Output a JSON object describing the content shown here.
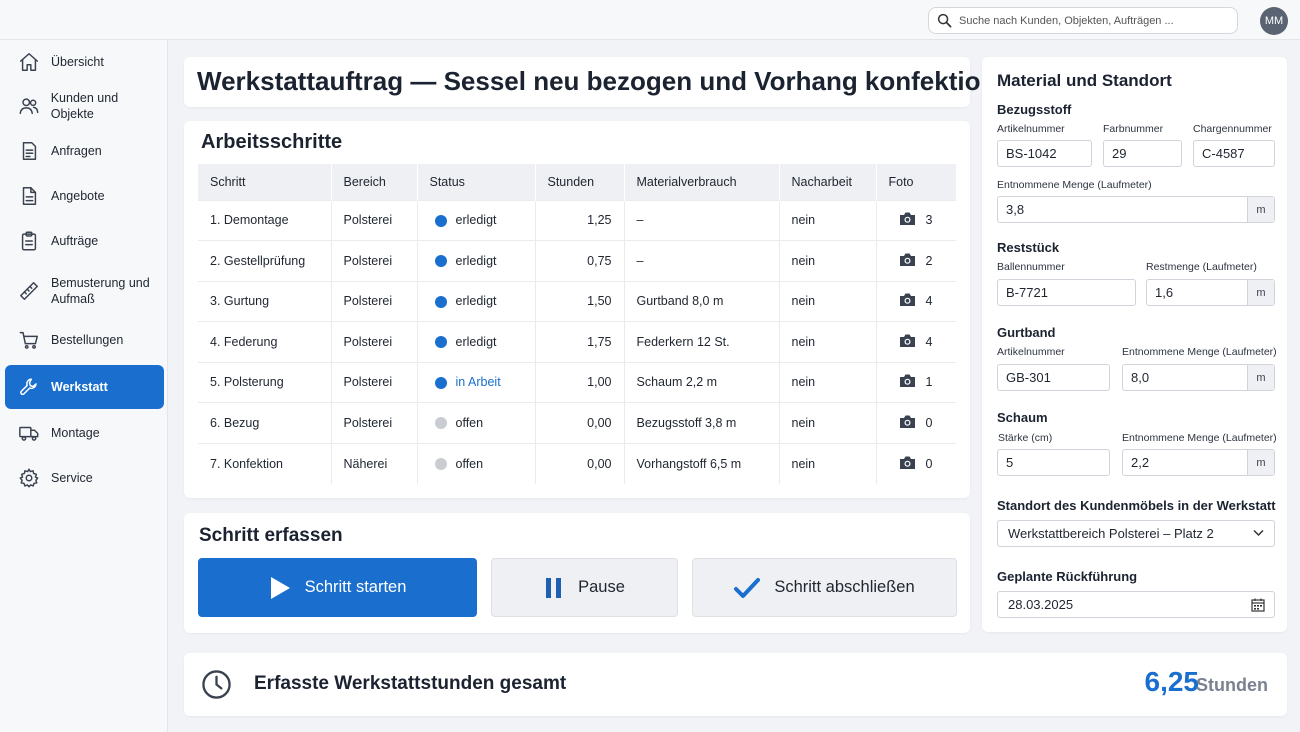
{
  "topbar": {
    "search_placeholder": "Suche nach Kunden, Objekten, Aufträgen ...",
    "avatar_initials": "MM"
  },
  "sidebar": {
    "items": [
      {
        "label": "Übersicht",
        "icon": "home-icon",
        "active": false
      },
      {
        "label": "Kunden und Objekte",
        "icon": "users-icon",
        "active": false
      },
      {
        "label": "Anfragen",
        "icon": "document-icon",
        "active": false
      },
      {
        "label": "Angebote",
        "icon": "document-icon",
        "active": false
      },
      {
        "label": "Aufträge",
        "icon": "clipboard-icon",
        "active": false
      },
      {
        "label": "Bemusterung und Aufmaß",
        "icon": "ruler-icon",
        "active": false
      },
      {
        "label": "Bestellungen",
        "icon": "cart-icon",
        "active": false
      },
      {
        "label": "Werkstatt",
        "icon": "wrench-icon",
        "active": true
      },
      {
        "label": "Montage",
        "icon": "truck-icon",
        "active": false
      },
      {
        "label": "Service",
        "icon": "gear-icon",
        "active": false
      }
    ]
  },
  "page": {
    "title": "Werkstattauftrag — Sessel neu bezogen und Vorhang konfektionieren"
  },
  "steps": {
    "heading": "Arbeitsschritte",
    "columns": [
      "Schritt",
      "Bereich",
      "Status",
      "Stunden",
      "Materialverbrauch",
      "Nacharbeit",
      "Foto"
    ],
    "rows": [
      {
        "step": "1.  Demontage",
        "area": "Polsterei",
        "status": "erledigt",
        "state": "done",
        "hours": "1,25",
        "material": "–",
        "rework": "nein",
        "photos": "3"
      },
      {
        "step": "2.  Gestellprüfung",
        "area": "Polsterei",
        "status": "erledigt",
        "state": "done",
        "hours": "0,75",
        "material": "–",
        "rework": "nein",
        "photos": "2"
      },
      {
        "step": "3.  Gurtung",
        "area": "Polsterei",
        "status": "erledigt",
        "state": "done",
        "hours": "1,50",
        "material": "Gurtband 8,0 m",
        "rework": "nein",
        "photos": "4"
      },
      {
        "step": "4.  Federung",
        "area": "Polsterei",
        "status": "erledigt",
        "state": "done",
        "hours": "1,75",
        "material": "Federkern 12 St.",
        "rework": "nein",
        "photos": "4"
      },
      {
        "step": "5.  Polsterung",
        "area": "Polsterei",
        "status": "in Arbeit",
        "state": "work",
        "hours": "1,00",
        "material": "Schaum 2,2 m",
        "rework": "nein",
        "photos": "1"
      },
      {
        "step": "6.  Bezug",
        "area": "Polsterei",
        "status": "offen",
        "state": "open",
        "hours": "0,00",
        "material": "Bezugsstoff 3,8 m",
        "rework": "nein",
        "photos": "0"
      },
      {
        "step": "7.  Konfektion",
        "area": "Näherei",
        "status": "offen",
        "state": "open",
        "hours": "0,00",
        "material": "Vorhangstoff 6,5 m",
        "rework": "nein",
        "photos": "0"
      }
    ]
  },
  "record": {
    "heading": "Schritt erfassen",
    "start_label": "Schritt starten",
    "pause_label": "Pause",
    "finish_label": "Schritt abschließen"
  },
  "total": {
    "label": "Erfasste Werkstattstunden gesamt",
    "value": "6,25",
    "unit": "Stunden"
  },
  "material": {
    "heading": "Material und Standort",
    "bezugsstoff": {
      "heading": "Bezugsstoff",
      "article_label": "Artikelnummer",
      "article": "BS-1042",
      "color_label": "Farbnummer",
      "color": "29",
      "batch_label": "Chargennummer",
      "batch": "C-4587",
      "qty_label": "Entnommene Menge (Laufmeter)",
      "qty": "3,8",
      "unit": "m"
    },
    "reststueck": {
      "heading": "Reststück",
      "bale_label": "Ballennummer",
      "bale": "B-7721",
      "rest_label": "Restmenge (Laufmeter)",
      "rest": "1,6",
      "unit": "m"
    },
    "gurtband": {
      "heading": "Gurtband",
      "article_label": "Artikelnummer",
      "article": "GB-301",
      "qty_label": "Entnommene Menge (Laufmeter)",
      "qty": "8,0",
      "unit": "m"
    },
    "schaum": {
      "heading": "Schaum",
      "thickness_label": "Stärke (cm)",
      "thickness": "5",
      "qty_label": "Entnommene Menge (Laufmeter)",
      "qty": "2,2",
      "unit": "m"
    },
    "location": {
      "heading": "Standort des Kundenmöbels in der Werkstatt",
      "value": "Werkstattbereich Polsterei – Platz 2"
    },
    "return": {
      "heading": "Geplante Rückführung",
      "value": "28.03.2025"
    }
  }
}
